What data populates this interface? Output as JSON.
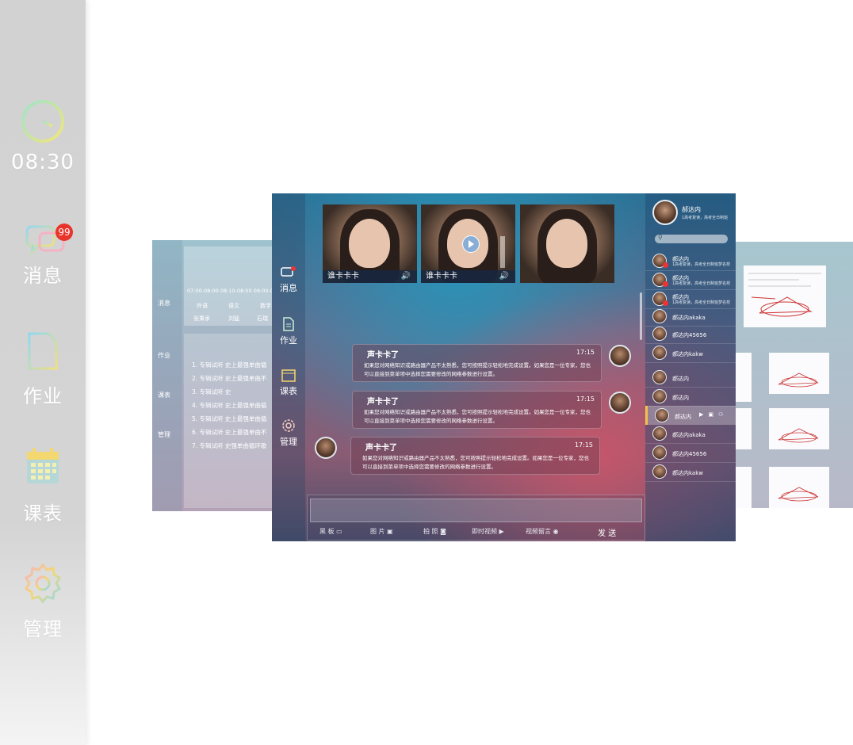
{
  "sidebar": {
    "time": "08:30",
    "messages": {
      "label": "消息",
      "badge": "99"
    },
    "homework": {
      "label": "作业"
    },
    "schedule": {
      "label": "课表"
    },
    "manage": {
      "label": "管理"
    }
  },
  "left_screen": {
    "nav": [
      "消息",
      "作业",
      "课表",
      "管理"
    ],
    "times": "07:00-08:00  08:10-08:50  09:00-0",
    "subjects": [
      "外语",
      "语文",
      "数学"
    ],
    "teachers": [
      "张秉承",
      "刘猛",
      "石瑞"
    ],
    "list": [
      "1. 专辑试听 史上最强单曲循",
      "2. 专辑试听 史上最强单曲不",
      "3. 专辑试听 史",
      "4. 专辑试听 史上最强单曲循",
      "5. 专辑试听 史上最强单曲循",
      "6. 专辑试听 史上最强单曲不",
      "7. 专辑试听 史强单曲循环歌"
    ]
  },
  "main_screen": {
    "nav": [
      "消息",
      "作业",
      "课表",
      "管理"
    ],
    "videos": [
      {
        "caption": "谁卡卡卡"
      },
      {
        "caption": "谁卡卡卡"
      },
      {
        "caption": ""
      }
    ],
    "messages": [
      {
        "name": "声卡卡了",
        "time": "17:15",
        "text": "如果您对网络知识或路由器产品不太熟悉，您可按照提示轻松地完成设置。如果您是一位专家，您也可以直接到菜单项中选择您需要修改的网络参数进行设置。"
      },
      {
        "name": "声卡卡了",
        "time": "17:15",
        "text": "如果您对网络知识或路由器产品不太熟悉，您可按照提示轻松地完成设置。如果您是一位专家，您也可以直接到菜单项中选择您需要修改的网络参数进行设置。"
      },
      {
        "name": "声卡卡了",
        "time": "17:15",
        "text": "如果您对网络知识或路由器产品不太熟悉，您可按照提示轻松地完成设置。如果您是一位专家，您也可以直接到菜单项中选择您需要修改的网络参数进行设置。"
      }
    ],
    "toolbar": {
      "blackboard": "黑 板",
      "image": "图 片",
      "photo": "拍 照",
      "instant_video": "即时视频",
      "video_message": "视频留言",
      "send": "发 送"
    },
    "profile": {
      "name": "郝达内",
      "status": "1高考复读，高考全日制班"
    },
    "contacts": [
      {
        "name": "郝达内",
        "sub": "1高考复读，高考全日制班梦名校"
      },
      {
        "name": "郝达内",
        "sub": "1高考复读，高考全日制班梦名校"
      },
      {
        "name": "郝达内",
        "sub": "1高考复读，高考全日制班梦名校"
      },
      {
        "name": "郝达内akaka",
        "sub": ""
      },
      {
        "name": "郝达内45656",
        "sub": ""
      },
      {
        "name": "郝达内kakw",
        "sub": ""
      },
      {
        "name": "郝达内",
        "sub": ""
      },
      {
        "name": "郝达内",
        "sub": ""
      },
      {
        "name": "郝达内",
        "sub": ""
      },
      {
        "name": "郝达内akaka",
        "sub": ""
      },
      {
        "name": "郝达内45656",
        "sub": ""
      },
      {
        "name": "郝达内kakw",
        "sub": ""
      }
    ]
  },
  "colors": {
    "badge": "#e8342a",
    "sidebar_bg": "#d3d3d3"
  }
}
